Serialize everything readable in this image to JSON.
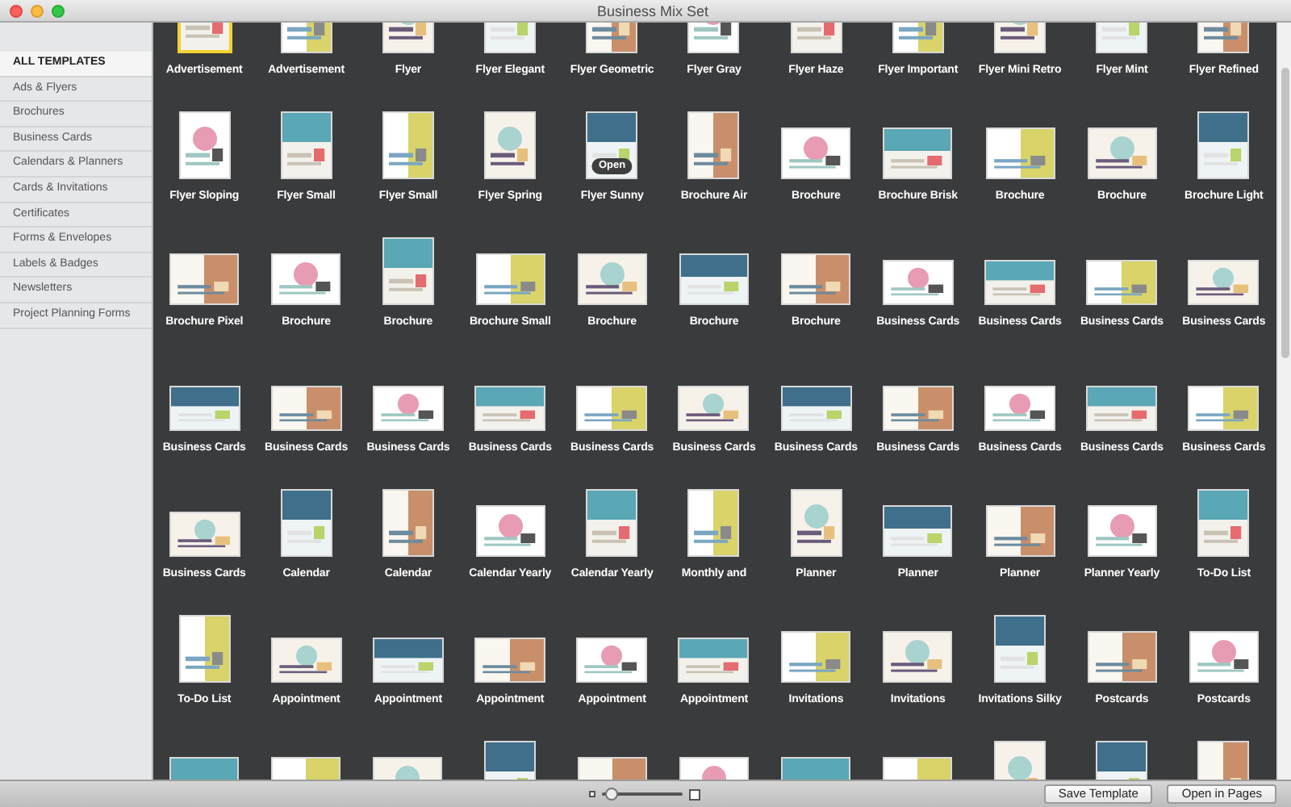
{
  "window": {
    "title": "Business Mix Set"
  },
  "sidebar": {
    "items": [
      {
        "label": "ALL TEMPLATES",
        "selected": true
      },
      {
        "label": "Ads & Flyers",
        "selected": false
      },
      {
        "label": "Brochures",
        "selected": false
      },
      {
        "label": "Business Cards",
        "selected": false
      },
      {
        "label": "Calendars & Planners",
        "selected": false
      },
      {
        "label": "Cards & Invitations",
        "selected": false
      },
      {
        "label": "Certificates",
        "selected": false
      },
      {
        "label": "Forms & Envelopes",
        "selected": false
      },
      {
        "label": "Labels & Badges",
        "selected": false
      },
      {
        "label": "Newsletters",
        "selected": false
      },
      {
        "label": "Project Planning Forms",
        "selected": false
      }
    ]
  },
  "templates": [
    {
      "label": "Advertisement",
      "kind": "portrait",
      "selected": true
    },
    {
      "label": "Advertisement",
      "kind": "portrait",
      "selected": false
    },
    {
      "label": "Flyer",
      "kind": "portrait",
      "selected": false
    },
    {
      "label": "Flyer Elegant",
      "kind": "portrait",
      "selected": false
    },
    {
      "label": "Flyer Geometric",
      "kind": "portrait",
      "selected": false
    },
    {
      "label": "Flyer Gray",
      "kind": "portrait",
      "selected": false
    },
    {
      "label": "Flyer Haze",
      "kind": "portrait",
      "selected": false
    },
    {
      "label": "Flyer Important",
      "kind": "portrait",
      "selected": false
    },
    {
      "label": "Flyer Mini Retro",
      "kind": "portrait",
      "selected": false
    },
    {
      "label": "Flyer Mint",
      "kind": "portrait",
      "selected": false
    },
    {
      "label": "Flyer Refined",
      "kind": "portrait",
      "selected": false
    },
    {
      "label": "Flyer Sloping",
      "kind": "portrait",
      "selected": false
    },
    {
      "label": "Flyer Small",
      "kind": "portrait",
      "selected": false
    },
    {
      "label": "Flyer Small",
      "kind": "portrait",
      "selected": false
    },
    {
      "label": "Flyer Spring",
      "kind": "portrait",
      "selected": false
    },
    {
      "label": "Flyer Sunny",
      "kind": "portrait",
      "selected": false,
      "badge": "Open"
    },
    {
      "label": "Brochure Air",
      "kind": "portrait",
      "selected": false
    },
    {
      "label": "Brochure",
      "kind": "landscape",
      "selected": false
    },
    {
      "label": "Brochure Brisk",
      "kind": "landscape",
      "selected": false
    },
    {
      "label": "Brochure",
      "kind": "landscape",
      "selected": false
    },
    {
      "label": "Brochure",
      "kind": "landscape",
      "selected": false
    },
    {
      "label": "Brochure Light",
      "kind": "portrait",
      "selected": false
    },
    {
      "label": "Brochure Pixel",
      "kind": "landscape",
      "selected": false
    },
    {
      "label": "Brochure",
      "kind": "landscape",
      "selected": false
    },
    {
      "label": "Brochure",
      "kind": "portrait",
      "selected": false
    },
    {
      "label": "Brochure Small",
      "kind": "landscape",
      "selected": false
    },
    {
      "label": "Brochure",
      "kind": "landscape",
      "selected": false
    },
    {
      "label": "Brochure",
      "kind": "landscape",
      "selected": false
    },
    {
      "label": "Brochure",
      "kind": "landscape",
      "selected": false
    },
    {
      "label": "Business Cards",
      "kind": "card",
      "selected": false
    },
    {
      "label": "Business Cards",
      "kind": "card",
      "selected": false
    },
    {
      "label": "Business Cards",
      "kind": "card",
      "selected": false
    },
    {
      "label": "Business Cards",
      "kind": "card",
      "selected": false
    },
    {
      "label": "Business Cards",
      "kind": "card",
      "selected": false
    },
    {
      "label": "Business Cards",
      "kind": "card",
      "selected": false
    },
    {
      "label": "Business Cards",
      "kind": "card",
      "selected": false
    },
    {
      "label": "Business Cards",
      "kind": "card",
      "selected": false
    },
    {
      "label": "Business Cards",
      "kind": "card",
      "selected": false
    },
    {
      "label": "Business Cards",
      "kind": "card",
      "selected": false
    },
    {
      "label": "Business Cards",
      "kind": "card",
      "selected": false
    },
    {
      "label": "Business Cards",
      "kind": "card",
      "selected": false
    },
    {
      "label": "Business Cards",
      "kind": "card",
      "selected": false
    },
    {
      "label": "Business Cards",
      "kind": "card",
      "selected": false
    },
    {
      "label": "Business Cards",
      "kind": "card",
      "selected": false
    },
    {
      "label": "Business Cards",
      "kind": "card",
      "selected": false
    },
    {
      "label": "Calendar",
      "kind": "portrait",
      "selected": false
    },
    {
      "label": "Calendar",
      "kind": "portrait",
      "selected": false
    },
    {
      "label": "Calendar Yearly",
      "kind": "landscape",
      "selected": false
    },
    {
      "label": "Calendar Yearly",
      "kind": "portrait",
      "selected": false
    },
    {
      "label": "Monthly and",
      "kind": "portrait",
      "selected": false
    },
    {
      "label": "Planner",
      "kind": "portrait",
      "selected": false
    },
    {
      "label": "Planner",
      "kind": "landscape",
      "selected": false
    },
    {
      "label": "Planner",
      "kind": "landscape",
      "selected": false
    },
    {
      "label": "Planner Yearly",
      "kind": "landscape",
      "selected": false
    },
    {
      "label": "To-Do List",
      "kind": "portrait",
      "selected": false
    },
    {
      "label": "To-Do List",
      "kind": "portrait",
      "selected": false
    },
    {
      "label": "Appointment",
      "kind": "card",
      "selected": false
    },
    {
      "label": "Appointment",
      "kind": "card",
      "selected": false
    },
    {
      "label": "Appointment",
      "kind": "card",
      "selected": false
    },
    {
      "label": "Appointment",
      "kind": "card",
      "selected": false
    },
    {
      "label": "Appointment",
      "kind": "card",
      "selected": false
    },
    {
      "label": "Invitations",
      "kind": "landscape",
      "selected": false
    },
    {
      "label": "Invitations",
      "kind": "landscape",
      "selected": false
    },
    {
      "label": "Invitations Silky",
      "kind": "portrait",
      "selected": false
    },
    {
      "label": "Postcards",
      "kind": "landscape",
      "selected": false
    },
    {
      "label": "Postcards",
      "kind": "landscape",
      "selected": false
    },
    {
      "kind": "landscape",
      "selected": false
    },
    {
      "kind": "landscape",
      "selected": false
    },
    {
      "kind": "landscape",
      "selected": false
    },
    {
      "kind": "portrait",
      "selected": false
    },
    {
      "kind": "landscape",
      "selected": false
    },
    {
      "kind": "landscape",
      "selected": false
    },
    {
      "kind": "landscape",
      "selected": false
    },
    {
      "kind": "landscape",
      "selected": false
    },
    {
      "kind": "portrait",
      "selected": false
    },
    {
      "kind": "portrait",
      "selected": false
    },
    {
      "kind": "portrait",
      "selected": false
    }
  ],
  "zoom": {
    "level": 0.12
  },
  "buttons": [
    {
      "label": "Save Template"
    },
    {
      "label": "Open in Pages"
    }
  ]
}
